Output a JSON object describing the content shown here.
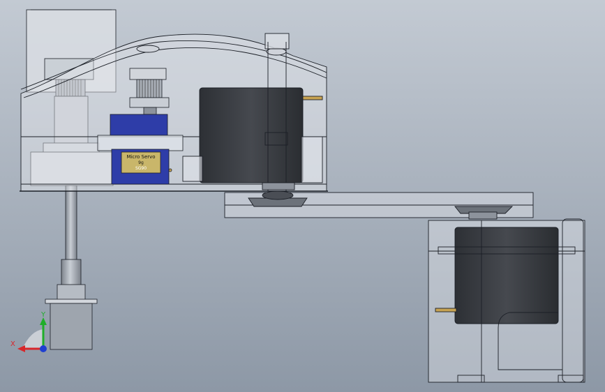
{
  "viewport": {
    "background_top": "#c3cad3",
    "background_bottom": "#8d98a6"
  },
  "servo_label": {
    "line1": "Micro Servo",
    "line2": "9g",
    "line3": "SG90"
  },
  "triad": {
    "x_label": "X",
    "y_label": "Y",
    "x_color": "#d8262a",
    "y_color": "#1fae2a",
    "z_color": "#1f3fd0"
  },
  "colors": {
    "housing": "#dfe3e9",
    "edge": "#1b1f26",
    "servo_dark": "#3c3f44",
    "micro_servo": "#2e3da8",
    "shaft": "#9aa0aa",
    "pin": "#c7a352"
  }
}
